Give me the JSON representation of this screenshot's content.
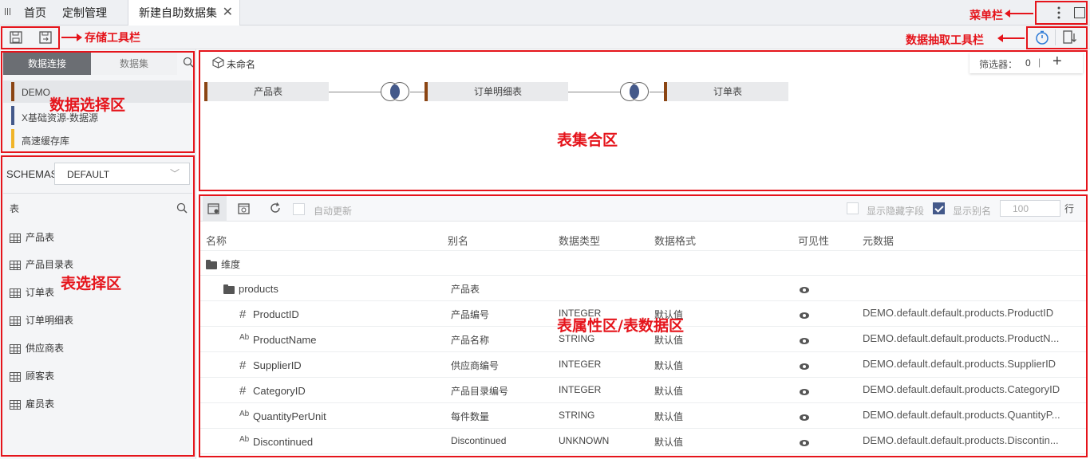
{
  "tabs": [
    {
      "label": "首页"
    },
    {
      "label": "定制管理"
    },
    {
      "label": "新建自助数据集"
    }
  ],
  "tab_close": "✕",
  "annotations": {
    "menu_bar": "菜单栏",
    "save_toolbar": "存储工具栏",
    "extract_toolbar": "数据抽取工具栏",
    "data_select": "数据选择区",
    "table_set": "表集合区",
    "table_select": "表选择区",
    "table_props": "表属性区/表数据区"
  },
  "left": {
    "subtabs": [
      "数据连接",
      "数据集"
    ],
    "connections": [
      {
        "label": "DEMO",
        "color": "#8b4513"
      },
      {
        "label": "X基础资源-数据源",
        "color": "#44598a"
      },
      {
        "label": "高速缓存库",
        "color": "#f0b429"
      }
    ],
    "schemas_label": "SCHEMAS",
    "schema_value": "DEFAULT",
    "tables_header": "表",
    "tables": [
      "产品表",
      "产品目录表",
      "订单表",
      "订单明细表",
      "供应商表",
      "顾客表",
      "雇员表"
    ]
  },
  "setarea": {
    "name": "未命名",
    "filter_label": "筛选器：",
    "filter_count": "0",
    "filter_sep": "|",
    "add": "+",
    "nodes": [
      "产品表",
      "订单明细表",
      "订单表"
    ]
  },
  "props": {
    "auto_update": "自动更新",
    "show_hidden": "显示隐藏字段",
    "show_alias": "显示别名",
    "rows_value": "100",
    "rows_unit": "行",
    "headers": [
      "名称",
      "别名",
      "数据类型",
      "数据格式",
      "可见性",
      "元数据"
    ],
    "dimension_label": "维度",
    "folder": {
      "name": "products",
      "alias": "产品表"
    },
    "fields": [
      {
        "kind": "#",
        "name": "ProductID",
        "alias": "产品编号",
        "type": "INTEGER",
        "format": "默认值",
        "meta": "DEMO.default.default.products.ProductID"
      },
      {
        "kind": "Ab",
        "name": "ProductName",
        "alias": "产品名称",
        "type": "STRING",
        "format": "默认值",
        "meta": "DEMO.default.default.products.ProductN..."
      },
      {
        "kind": "#",
        "name": "SupplierID",
        "alias": "供应商编号",
        "type": "INTEGER",
        "format": "默认值",
        "meta": "DEMO.default.default.products.SupplierID"
      },
      {
        "kind": "#",
        "name": "CategoryID",
        "alias": "产品目录编号",
        "type": "INTEGER",
        "format": "默认值",
        "meta": "DEMO.default.default.products.CategoryID"
      },
      {
        "kind": "Ab",
        "name": "QuantityPerUnit",
        "alias": "每件数量",
        "type": "STRING",
        "format": "默认值",
        "meta": "DEMO.default.default.products.QuantityP..."
      },
      {
        "kind": "Ab",
        "name": "Discontinued",
        "alias": "Discontinued",
        "type": "UNKNOWN",
        "format": "默认值",
        "meta": "DEMO.default.default.products.Discontin..."
      }
    ]
  },
  "colors": {
    "annotation_red": "#e5141b",
    "accent": "#44598a",
    "brown": "#8b4513"
  }
}
